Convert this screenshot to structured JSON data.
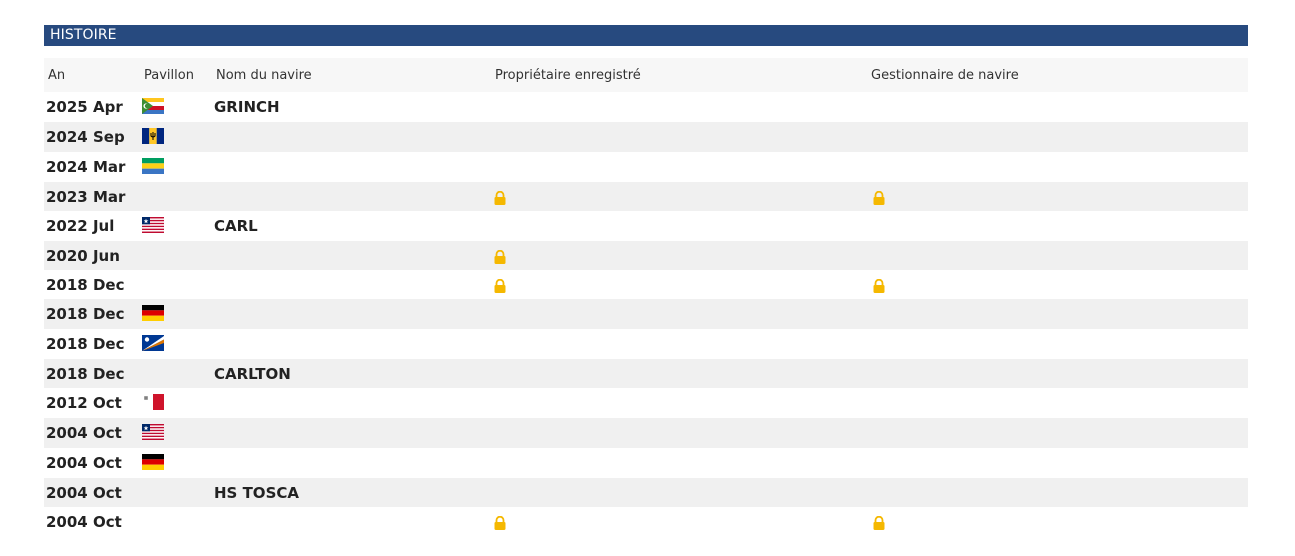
{
  "section": {
    "title": "HISTOIRE"
  },
  "columns": {
    "year": "An",
    "flag": "Pavillon",
    "vessel_name": "Nom du navire",
    "registered_owner": "Propriétaire enregistré",
    "ship_manager": "Gestionnaire de navire"
  },
  "colors": {
    "header_bar": "#274a7f",
    "lock": "#f5b800",
    "alt_row": "#f0f0f0"
  },
  "rows": [
    {
      "year": "2025 Apr",
      "flag": "comoros",
      "name": "GRINCH",
      "owner_locked": false,
      "manager_locked": false
    },
    {
      "year": "2024 Sep",
      "flag": "barbados",
      "name": "",
      "owner_locked": false,
      "manager_locked": false
    },
    {
      "year": "2024 Mar",
      "flag": "gabon",
      "name": "",
      "owner_locked": false,
      "manager_locked": false
    },
    {
      "year": "2023 Mar",
      "flag": "",
      "name": "",
      "owner_locked": true,
      "manager_locked": true
    },
    {
      "year": "2022 Jul",
      "flag": "liberia",
      "name": "CARL",
      "owner_locked": false,
      "manager_locked": false
    },
    {
      "year": "2020 Jun",
      "flag": "",
      "name": "",
      "owner_locked": true,
      "manager_locked": false
    },
    {
      "year": "2018 Dec",
      "flag": "",
      "name": "",
      "owner_locked": true,
      "manager_locked": true
    },
    {
      "year": "2018 Dec",
      "flag": "germany",
      "name": "",
      "owner_locked": false,
      "manager_locked": false
    },
    {
      "year": "2018 Dec",
      "flag": "marshall-islands",
      "name": "",
      "owner_locked": false,
      "manager_locked": false
    },
    {
      "year": "2018 Dec",
      "flag": "",
      "name": "CARLTON",
      "owner_locked": false,
      "manager_locked": false
    },
    {
      "year": "2012 Oct",
      "flag": "malta",
      "name": "",
      "owner_locked": false,
      "manager_locked": false
    },
    {
      "year": "2004 Oct",
      "flag": "liberia",
      "name": "",
      "owner_locked": false,
      "manager_locked": false
    },
    {
      "year": "2004 Oct",
      "flag": "germany",
      "name": "",
      "owner_locked": false,
      "manager_locked": false
    },
    {
      "year": "2004 Oct",
      "flag": "",
      "name": "HS TOSCA",
      "owner_locked": false,
      "manager_locked": false
    },
    {
      "year": "2004 Oct",
      "flag": "",
      "name": "",
      "owner_locked": true,
      "manager_locked": true
    }
  ]
}
